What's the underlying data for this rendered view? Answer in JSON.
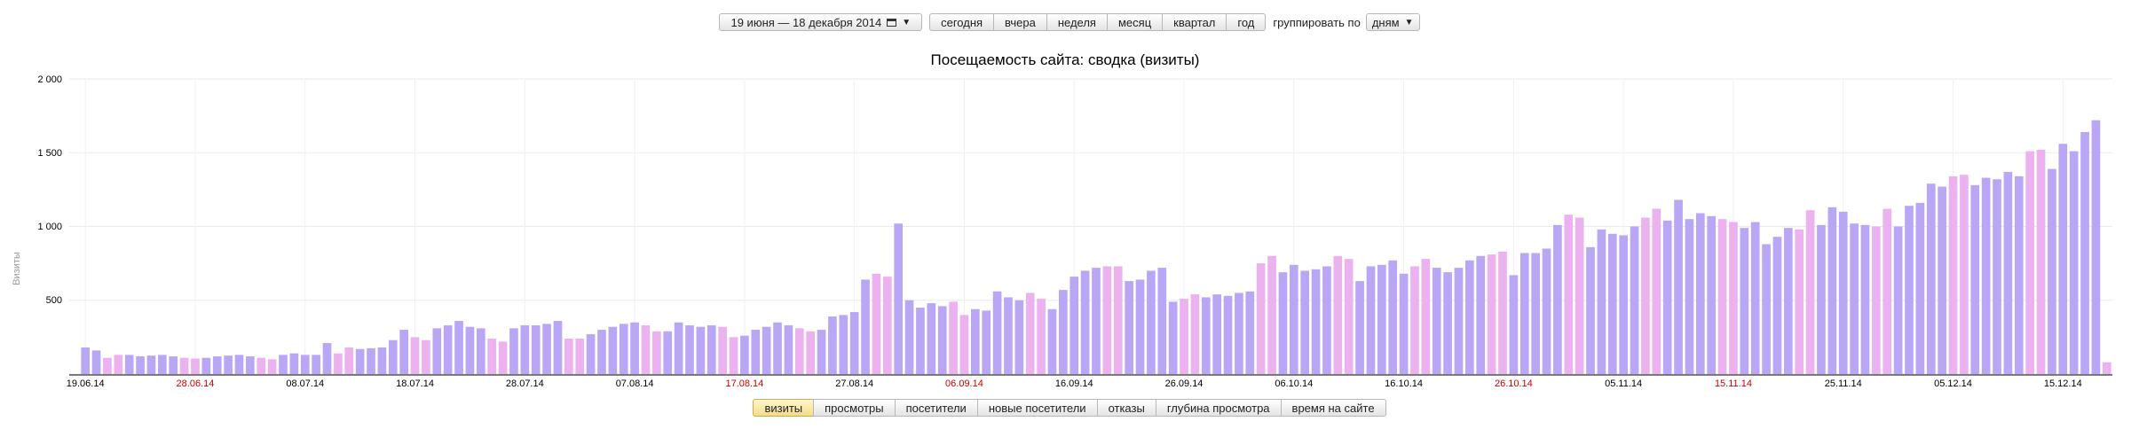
{
  "toolbar": {
    "date_range": "19 июня — 18 декабря 2014",
    "periods": [
      "сегодня",
      "вчера",
      "неделя",
      "месяц",
      "квартал",
      "год"
    ],
    "group_label": "группировать по",
    "group_value": "дням"
  },
  "tabs": [
    "визиты",
    "просмотры",
    "посетители",
    "новые посетители",
    "отказы",
    "глубина просмотра",
    "время на сайте"
  ],
  "active_tab": 0,
  "colors": {
    "weekday": "#b9a6f4",
    "weekend": "#ecb1ef",
    "weekend_label": "#cc0000",
    "axis_label": "#999999"
  },
  "chart_data": {
    "type": "bar",
    "title": "Посещаемость сайта: сводка (визиты)",
    "ylabel": "Визиты",
    "ylim": [
      0,
      2000
    ],
    "yticks": [
      "2 000",
      "1 500",
      "1 000",
      "500"
    ],
    "x_start": "2014-06-19",
    "x_end": "2014-12-18",
    "xticks": [
      {
        "label": "19.06.14",
        "weekend": false
      },
      {
        "label": "28.06.14",
        "weekend": true
      },
      {
        "label": "08.07.14",
        "weekend": false
      },
      {
        "label": "18.07.14",
        "weekend": false
      },
      {
        "label": "28.07.14",
        "weekend": false
      },
      {
        "label": "07.08.14",
        "weekend": false
      },
      {
        "label": "17.08.14",
        "weekend": true
      },
      {
        "label": "27.08.14",
        "weekend": false
      },
      {
        "label": "06.09.14",
        "weekend": true
      },
      {
        "label": "16.09.14",
        "weekend": false
      },
      {
        "label": "26.09.14",
        "weekend": false
      },
      {
        "label": "06.10.14",
        "weekend": false
      },
      {
        "label": "16.10.14",
        "weekend": false
      },
      {
        "label": "26.10.14",
        "weekend": true
      },
      {
        "label": "05.11.14",
        "weekend": false
      },
      {
        "label": "15.11.14",
        "weekend": true
      },
      {
        "label": "25.11.14",
        "weekend": false
      },
      {
        "label": "05.12.14",
        "weekend": false
      },
      {
        "label": "15.12.14",
        "weekend": false
      }
    ],
    "values": [
      180,
      160,
      110,
      130,
      130,
      120,
      125,
      130,
      120,
      110,
      105,
      110,
      120,
      125,
      130,
      120,
      110,
      100,
      130,
      140,
      130,
      130,
      210,
      140,
      180,
      170,
      175,
      180,
      230,
      300,
      250,
      230,
      310,
      330,
      360,
      320,
      310,
      240,
      220,
      310,
      330,
      330,
      340,
      360,
      240,
      240,
      270,
      300,
      320,
      340,
      350,
      330,
      290,
      290,
      350,
      330,
      320,
      330,
      320,
      250,
      260,
      300,
      320,
      350,
      330,
      310,
      290,
      300,
      390,
      400,
      420,
      640,
      680,
      660,
      1020,
      500,
      450,
      480,
      460,
      490,
      400,
      440,
      430,
      560,
      520,
      500,
      550,
      510,
      440,
      570,
      660,
      700,
      720,
      730,
      730,
      630,
      640,
      700,
      720,
      490,
      510,
      540,
      520,
      540,
      530,
      550,
      560,
      750,
      800,
      690,
      740,
      700,
      710,
      730,
      800,
      780,
      630,
      730,
      740,
      770,
      680,
      730,
      780,
      720,
      690,
      720,
      770,
      800,
      810,
      830,
      670,
      820,
      820,
      850,
      1010,
      1080,
      1060,
      860,
      980,
      950,
      940,
      1000,
      1060,
      1120,
      1040,
      1180,
      1050,
      1090,
      1070,
      1050,
      1030,
      990,
      1030,
      880,
      930,
      990,
      980,
      1110,
      1010,
      1130,
      1100,
      1020,
      1010,
      1000,
      1120,
      1000,
      1140,
      1160,
      1290,
      1270,
      1340,
      1350,
      1280,
      1330,
      1320,
      1370,
      1340,
      1510,
      1520,
      1390,
      1560,
      1510,
      1640,
      1720,
      80
    ]
  }
}
